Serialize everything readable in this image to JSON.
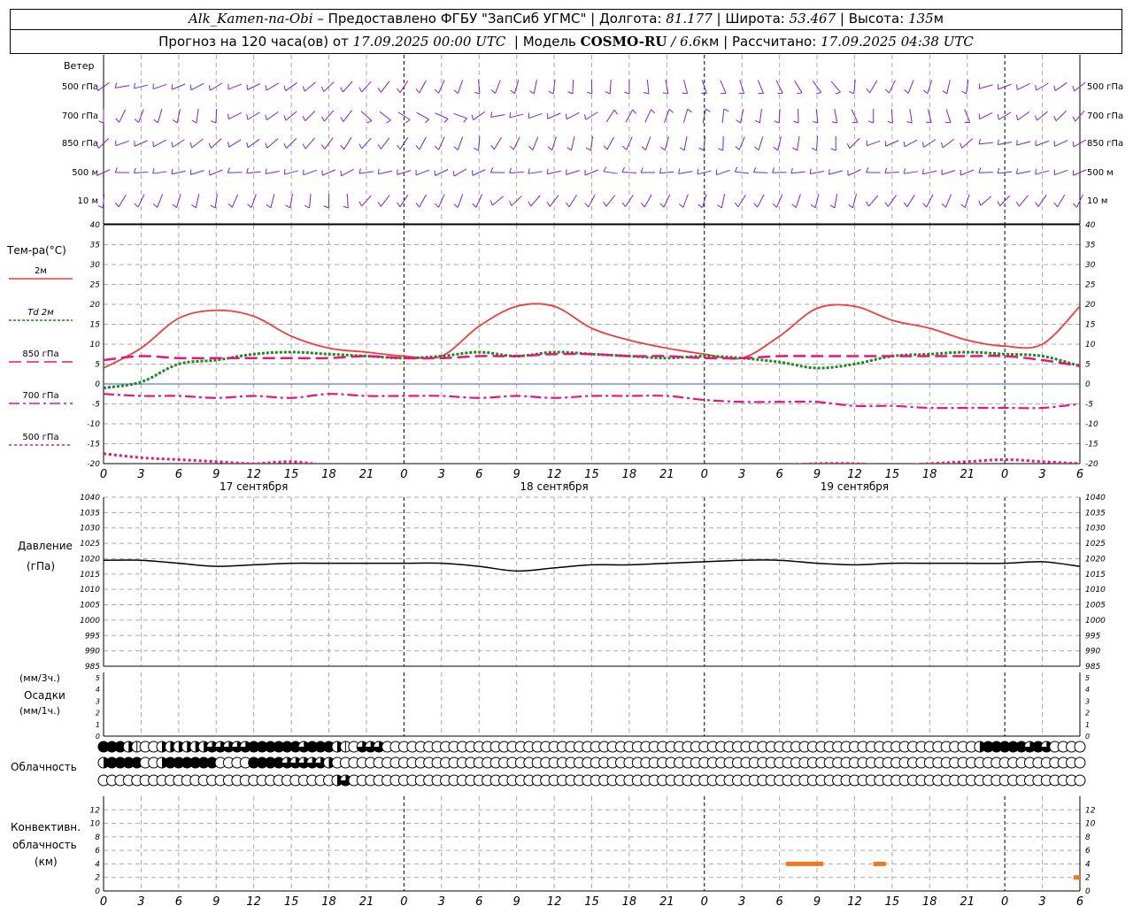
{
  "header": {
    "station": "Alk_Kamen-na-Obi",
    "provider": "– Предоставлено ФГБУ \"ЗапСиб УГМС\"",
    "lon_label": "Долгота:",
    "lon": "81.177",
    "lat_label": "Широта:",
    "lat": "53.467",
    "alt_label": "Высота:",
    "alt": "135",
    "alt_unit": "м",
    "forecast_label": "Прогноз на 120 часа(ов) от",
    "forecast_start": "17.09.2025 00:00 UTC",
    "model_label": "Модель",
    "model": "COSMO-RU",
    "resolution": "/ 6.6",
    "res_unit": "км",
    "calc_label": "Рассчитано:",
    "calc_time": "17.09.2025 04:38 UTC"
  },
  "wind_panel": {
    "title": "Ветер",
    "levels": [
      "500 гПа",
      "700 гПа",
      "850 гПа",
      "500 м",
      "10  м"
    ]
  },
  "temp_panel": {
    "title": "Тем-ра(°С)",
    "legend": [
      {
        "label": "2м",
        "color": "#f03c3c",
        "dash": "none"
      },
      {
        "label": "Td  2м",
        "color": "#1a8a1a",
        "dash": "3,2"
      },
      {
        "label": "850 гПа",
        "color": "#e8147c",
        "dash": "14,6"
      },
      {
        "label": "700 гПа",
        "color": "#e8147c",
        "dash": "12,4,3,4"
      },
      {
        "label": "500 гПа",
        "color": "#e8147c",
        "dash": "3,3"
      }
    ],
    "ylim": [
      -20,
      40
    ],
    "yticks": [
      40,
      35,
      30,
      25,
      20,
      15,
      10,
      5,
      0,
      -5,
      -10,
      -15,
      -20
    ]
  },
  "pressure_panel": {
    "title": "Давление",
    "unit": "(гПа)",
    "ylim": [
      985,
      1040
    ],
    "yticks": [
      1040,
      1035,
      1030,
      1025,
      1020,
      1015,
      1010,
      1005,
      1000,
      995,
      990,
      985
    ]
  },
  "precip_panel": {
    "unit1": "(мм/3ч.)",
    "title": "Осадки",
    "unit2": "(мм/1ч.)",
    "yticks": [
      5,
      4,
      3,
      2,
      1,
      0
    ]
  },
  "cloud_panel": {
    "title": "Облачность",
    "rows": [
      "4442100222222333334444443444210333000000000000000000000000000000000000000000000000000000000000000000000002444443430000",
      "2444400244444400004444333332000000000000000000000000000000000000000000000000000000000000000000000000000000000000000000",
      "0000000000000000000000000000230000000000000000000000000000000000000000000000000000000000000000000000000000000000000000"
    ]
  },
  "conv_panel": {
    "title1": "Конвективн.",
    "title2": "облачность",
    "unit": "(км)",
    "ylim": [
      0,
      14
    ],
    "yticks": [
      12,
      10,
      8,
      6,
      4,
      2,
      0
    ]
  },
  "time_axis": {
    "tick_labels": [
      "0",
      "3",
      "6",
      "9",
      "12",
      "15",
      "18",
      "21",
      "0",
      "3",
      "6",
      "9",
      "12",
      "15",
      "18",
      "21",
      "0",
      "3",
      "6",
      "9",
      "12",
      "15",
      "18",
      "21",
      "0",
      "3",
      "6"
    ],
    "day_labels": [
      "17 сентября",
      "18 сентября",
      "19 сентября"
    ]
  },
  "chart_data": {
    "type": "line",
    "title": "Alk_Kamen-na-Obi",
    "x_hours": [
      0,
      3,
      6,
      9,
      12,
      15,
      18,
      21,
      24,
      27,
      30,
      33,
      36,
      39,
      42,
      45,
      48,
      51,
      54,
      57,
      60,
      63,
      66,
      69,
      72,
      75,
      78
    ],
    "xlim": [
      0,
      78
    ],
    "series": [
      {
        "name": "2м",
        "panel": "temp",
        "values": [
          4,
          9,
          16.5,
          18.5,
          17,
          12,
          9,
          8,
          7,
          7,
          14.5,
          19.5,
          19.5,
          14,
          11,
          9,
          7.5,
          6.5,
          12,
          19,
          19.5,
          16,
          14,
          11,
          9.5,
          10,
          19.5
        ]
      },
      {
        "name": "Td  2м",
        "panel": "temp",
        "values": [
          -1,
          0.5,
          5,
          6,
          7.5,
          8,
          7.5,
          7,
          6.5,
          7,
          8,
          7,
          8,
          7.5,
          7,
          6.5,
          7,
          6.5,
          5.5,
          4,
          5,
          7,
          7.5,
          8,
          7.5,
          7,
          4.5
        ]
      },
      {
        "name": "850 гПа",
        "panel": "temp",
        "values": [
          6,
          7,
          6.5,
          6.5,
          6.5,
          6.5,
          6.5,
          7,
          6.5,
          6.5,
          7,
          7,
          7.5,
          7.5,
          7,
          7,
          6.5,
          6.5,
          7,
          7,
          7,
          7,
          7,
          7,
          7,
          6,
          4.5
        ]
      },
      {
        "name": "700 гПа",
        "panel": "temp",
        "values": [
          -2.5,
          -3,
          -3,
          -3.5,
          -3,
          -3.5,
          -2.5,
          -3,
          -3,
          -3,
          -3.5,
          -3,
          -3.5,
          -3,
          -3,
          -3,
          -4,
          -4.5,
          -4.5,
          -4.5,
          -5.5,
          -5.5,
          -6,
          -6,
          -6,
          -6,
          -5
        ]
      },
      {
        "name": "500 гПа",
        "panel": "temp",
        "values": [
          -17.5,
          -18.5,
          -19,
          -19.5,
          -20,
          -19.5,
          -20.5,
          -21,
          -21,
          -21,
          -21,
          -21,
          -21,
          -21,
          -21,
          -21,
          -21,
          -21,
          -20.5,
          -20,
          -20,
          -20.5,
          -20,
          -19.5,
          -19,
          -19.5,
          -20
        ]
      },
      {
        "name": "Давление",
        "panel": "pressure",
        "values": [
          1019.5,
          1019.5,
          1018.5,
          1017.5,
          1018,
          1018.5,
          1018.5,
          1018.5,
          1018.5,
          1018.5,
          1017.5,
          1016,
          1017,
          1018,
          1018,
          1018.5,
          1019,
          1019.5,
          1019.5,
          1018.5,
          1018,
          1018.5,
          1018.5,
          1018.5,
          1018.5,
          1019,
          1017.5
        ]
      }
    ],
    "conv_bars": [
      {
        "x_start": 54.5,
        "x_end": 57.5,
        "value": 4
      },
      {
        "x_start": 61.5,
        "x_end": 62.5,
        "value": 4
      },
      {
        "x_start": 77.5,
        "x_end": 78,
        "value": 2
      }
    ]
  }
}
